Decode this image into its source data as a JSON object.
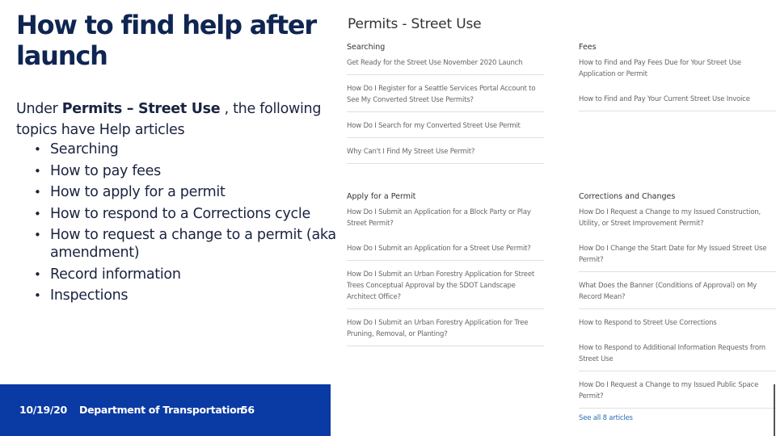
{
  "slide": {
    "title": "How to find help after launch",
    "intro_prefix": "Under ",
    "intro_bold": "Permits – Street Use",
    "intro_suffix": " , the following topics have Help articles",
    "topics": [
      "Searching",
      "How to pay fees",
      "How to apply for a permit",
      "How to respond to a Corrections cycle",
      "How to request a change to a permit (aka amendment)",
      "Record information",
      "Inspections"
    ],
    "footer": {
      "date": "10/19/20",
      "department": "Department of Transportation",
      "page": "56",
      "bg_color": "#0a3aa3"
    }
  },
  "screenshot": {
    "title": "Permits - Street Use",
    "sections": {
      "searching": {
        "heading": "Searching",
        "items": [
          "Get Ready for the Street Use November 2020 Launch",
          "How Do I Register for a Seattle Services Portal Account to See My Converted Street Use Permits?",
          "How Do I Search for my Converted Street Use Permit",
          "Why Can't I Find My Street Use Permit?"
        ]
      },
      "fees": {
        "heading": "Fees",
        "items": [
          "How to Find and Pay Fees Due for Your Street Use Application or Permit",
          "How to Find and Pay Your Current Street Use Invoice"
        ]
      },
      "apply": {
        "heading": "Apply for a Permit",
        "items": [
          "How Do I Submit an Application for a Block Party or Play Street Permit?",
          "How Do I Submit an Application for a Street Use Permit?",
          "How Do I Submit an Urban Forestry Application for Street Trees Conceptual Approval by the SDOT Landscape Architect Office?",
          "How Do I Submit an Urban Forestry Application for Tree Pruning, Removal, or Planting?"
        ]
      },
      "corrections": {
        "heading": "Corrections and Changes",
        "items": [
          "How Do I Request a Change to my Issued Construction, Utility, or Street Improvement Permit?",
          "How Do I Change the Start Date for My Issued Street Use Permit?",
          "What Does the Banner (Conditions of Approval) on My Record Mean?",
          "How to Respond to Street Use Corrections",
          "How to Respond to Additional Information Requests from Street Use",
          "How Do I Request a Change to my Issued Public Space Permit?"
        ],
        "see_all": "See all 8 articles"
      }
    },
    "link_color": "#2a6db5"
  }
}
